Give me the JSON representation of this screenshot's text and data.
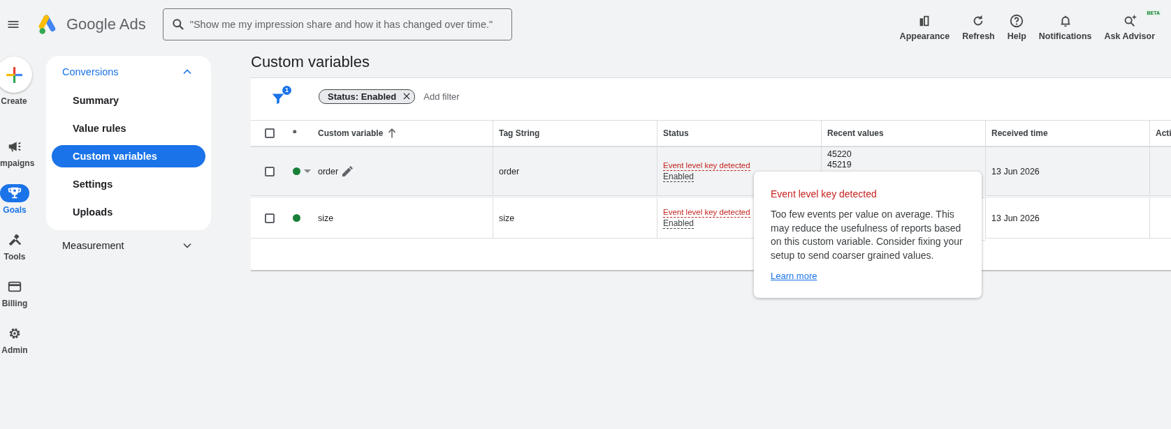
{
  "topbar": {
    "product": "Google Ads",
    "search": {
      "placeholder": "\"Show me my impression share and how it has changed over time.\""
    },
    "actions": [
      {
        "kind": "appearance",
        "label": "Appearance"
      },
      {
        "kind": "refresh",
        "label": "Refresh"
      },
      {
        "kind": "help",
        "label": "Help"
      },
      {
        "kind": "notifications",
        "label": "Notifications"
      },
      {
        "kind": "advisor",
        "label": "Ask Advisor",
        "badge": "BETA"
      }
    ]
  },
  "rail": [
    {
      "kind": "create",
      "label": "Create",
      "selected": false
    },
    {
      "kind": "campaigns",
      "label": "mpaigns",
      "selected": false
    },
    {
      "kind": "goals",
      "label": "Goals",
      "selected": true
    },
    {
      "kind": "tools",
      "label": "Tools",
      "selected": false
    },
    {
      "kind": "billing",
      "label": "Billing",
      "selected": false
    },
    {
      "kind": "admin",
      "label": "Admin",
      "selected": false
    }
  ],
  "sidebar": [
    {
      "label": "Conversions",
      "expanded": true,
      "items": [
        {
          "label": "Summary",
          "selected": false
        },
        {
          "label": "Value rules",
          "selected": false
        },
        {
          "label": "Custom variables",
          "selected": true
        },
        {
          "label": "Settings",
          "selected": false
        },
        {
          "label": "Uploads",
          "selected": false
        }
      ]
    },
    {
      "label": "Measurement",
      "expanded": false
    }
  ],
  "page_title": "Custom variables",
  "filter": {
    "count": "1",
    "chips": [
      "Status: Enabled"
    ],
    "add_filter": "Add filter"
  },
  "table": {
    "select_all": {
      "checked": false
    },
    "columns": [
      {
        "label": "Custom variable",
        "sorted": true
      },
      {
        "label": "Tag String"
      },
      {
        "label": "Status"
      },
      {
        "label": "Recent values"
      },
      {
        "label": "Received time"
      },
      {
        "label": "Acti"
      }
    ],
    "rows": [
      {
        "selected": false,
        "hovered": true,
        "color": "#188038",
        "expandable": true,
        "name": "order",
        "editable": true,
        "tag": "order",
        "warning": "Event level key detected",
        "status": "Enabled",
        "recent_values": [
          "45220",
          "45219"
        ],
        "received": "13 Jun 2026"
      },
      {
        "selected": false,
        "hovered": false,
        "color": "#188038",
        "expandable": false,
        "name": "size",
        "editable": false,
        "tag": "size",
        "warning": "Event level key detected",
        "status": "Enabled",
        "received": "13 Jun 2026"
      }
    ]
  },
  "tooltip": {
    "title": "Event level key detected",
    "text": "Too few events per value on average. This may reduce the usefulness of reports based on this custom variable. Consider fixing your setup to send coarser grained values.",
    "link": "Learn more"
  }
}
